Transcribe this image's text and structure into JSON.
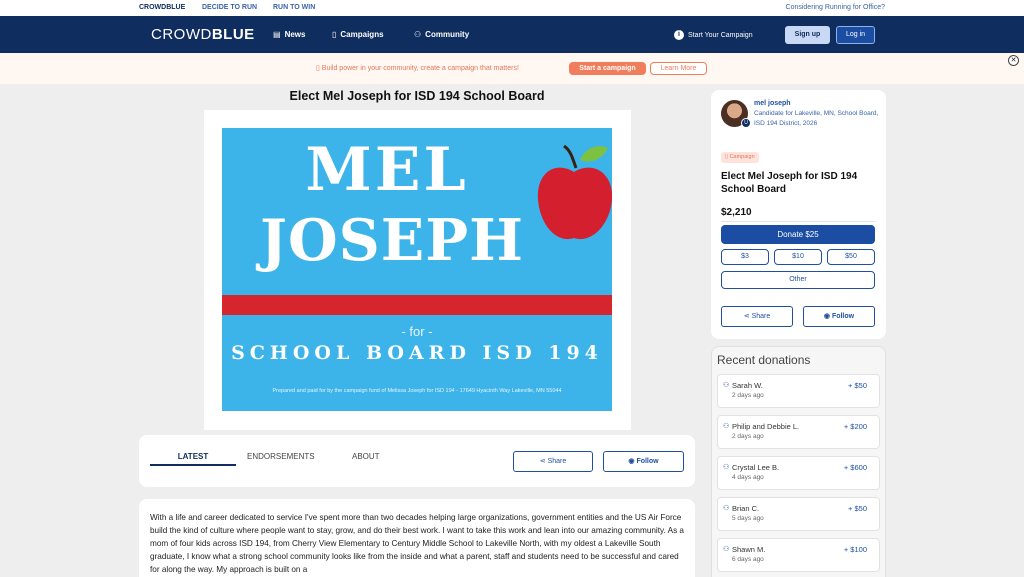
{
  "topbar": {
    "brand": "CROWDBLUE",
    "links": [
      "DECIDE TO RUN",
      "RUN TO WIN"
    ],
    "right_link": "Considering Running for Office?"
  },
  "nav": {
    "logo_a": "CROWD",
    "logo_b": "BLUE",
    "news": "News",
    "campaigns": "Campaigns",
    "community": "Community",
    "start_campaign": "Start Your Campaign",
    "signup": "Sign up",
    "login": "Log in",
    "icons": {
      "news": "newspaper-icon",
      "campaigns": "clipboard-icon",
      "community": "people-icon",
      "start": "info-icon"
    }
  },
  "promo": {
    "text": "Build power in your community, create a campaign that matters!",
    "start": "Start a campaign",
    "learn": "Learn More"
  },
  "campaign": {
    "title": "Elect Mel Joseph for ISD 194 School Board",
    "poster": {
      "line1": "MEL",
      "line2": "JOSEPH",
      "for": "- for -",
      "board": "SCHOOL BOARD ISD 194",
      "disclaimer": "Prepared and paid for by the campaign fund of Melissa Joseph for ISD 194 - 17649 Hyacinth Way Lakeville, MN 55044",
      "colors": {
        "background": "#3cb4ea",
        "stripe": "#d6262d",
        "apple": "#d41f2e"
      }
    }
  },
  "tabs": {
    "latest": "LATEST",
    "endorsements": "ENDORSEMENTS",
    "about": "ABOUT",
    "share": "Share",
    "follow": "Follow"
  },
  "story": {
    "text": "With a life and career dedicated to service I've spent more than two decades helping large organizations, government entities and the US Air Force build the kind of culture where people want to stay, grow, and do their best work. I want to take this work and lean into our amazing community. As a mom of four kids across ISD 194, from Cherry View Elementary to Century Middle School to Lakeville North, with my oldest a Lakeville South graduate, I know what a strong school community looks like from the inside and what a parent, staff and students need to be successful and cared for along the way. My approach is built on a"
  },
  "card": {
    "candidate_name": "mel joseph",
    "candidate_desc": "Candidate for Lakeville, MN, School Board, ISD 194 District, 2026",
    "badge": "Campaign",
    "title": "Elect Mel Joseph for ISD 194 School Board",
    "amount": "$2,210",
    "donate": "Donate $25",
    "amounts": [
      "$3",
      "$10",
      "$50"
    ],
    "other": "Other",
    "share": "Share",
    "follow": "Follow"
  },
  "recent": {
    "title": "Recent donations",
    "items": [
      {
        "name": "Sarah W.",
        "when": "2 days ago",
        "amount": "+ $50"
      },
      {
        "name": "Philip and Debbie L.",
        "when": "2 days ago",
        "amount": "+ $200"
      },
      {
        "name": "Crystal Lee B.",
        "when": "4 days ago",
        "amount": "+ $600"
      },
      {
        "name": "Brian C.",
        "when": "5 days ago",
        "amount": "+ $50"
      },
      {
        "name": "Shawn M.",
        "when": "6 days ago",
        "amount": "+ $100"
      }
    ]
  }
}
